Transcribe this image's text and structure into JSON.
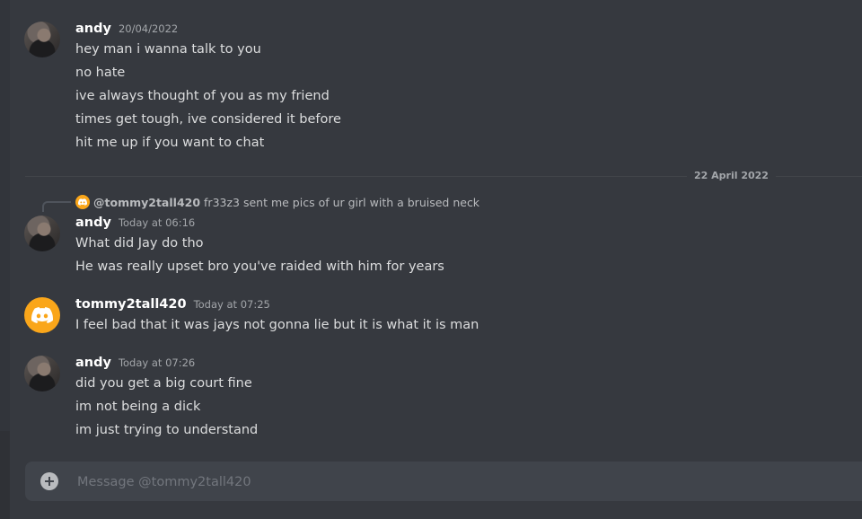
{
  "groups": [
    {
      "username": "andy",
      "timestamp": "20/04/2022",
      "messages": [
        "hey man i wanna talk to you",
        "no hate",
        "ive always thought of you as my friend",
        "times get tough, ive considered it before",
        "hit me up if you want to chat"
      ]
    },
    {
      "reply": {
        "username": "@tommy2tall420",
        "text": "fr33z3 sent me pics of ur girl with a bruised neck"
      },
      "username": "andy",
      "timestamp": "Today at 06:16",
      "messages": [
        "What did Jay do tho",
        "He was really upset bro you've raided with him for years"
      ]
    },
    {
      "username": "tommy2tall420",
      "timestamp": "Today at 07:25",
      "messages": [
        "I feel bad that it was jays not gonna lie but it is what it is man"
      ]
    },
    {
      "username": "andy",
      "timestamp": "Today at 07:26",
      "messages": [
        "did you get a big court fine",
        "im not being a dick",
        "im just trying to understand"
      ]
    }
  ],
  "date_divider": "22 April 2022",
  "composer": {
    "placeholder": "Message @tommy2tall420"
  },
  "icons": {
    "default_avatar": "discord-logo-icon",
    "add": "plus-icon"
  },
  "colors": {
    "background": "#36393f",
    "discord_avatar": "#faa61a",
    "composer": "#40444b"
  }
}
